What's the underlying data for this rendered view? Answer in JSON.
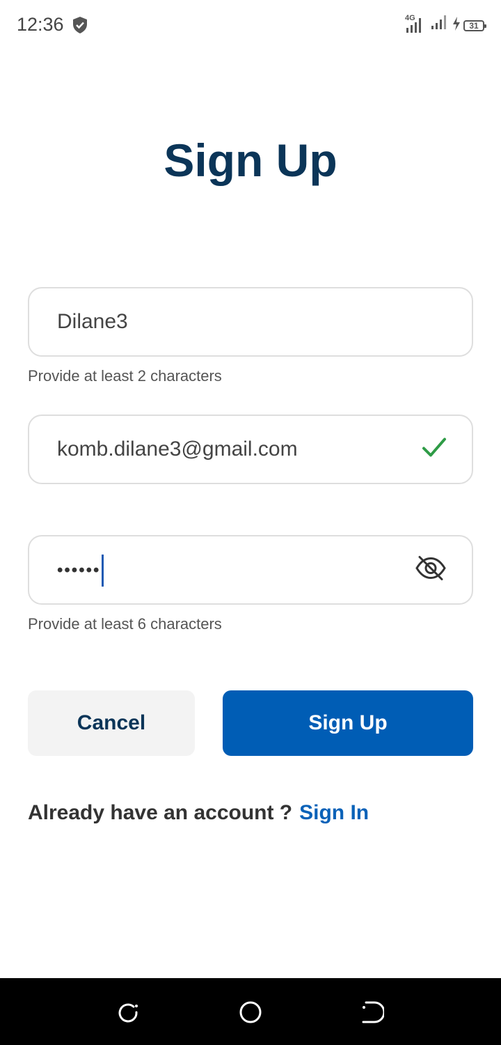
{
  "status_bar": {
    "time": "12:36",
    "network": "4G",
    "battery": "31"
  },
  "title": "Sign Up",
  "form": {
    "username": {
      "value": "Dilane3",
      "hint": "Provide at least 2 characters"
    },
    "email": {
      "value": "komb.dilane3@gmail.com",
      "valid_color": "#2e9b46"
    },
    "password": {
      "masked_value": "••••••",
      "hint": "Provide at least 6 characters"
    }
  },
  "buttons": {
    "cancel": "Cancel",
    "signup": "Sign Up"
  },
  "footer": {
    "prompt": "Already have an account ?",
    "link": "Sign In"
  },
  "colors": {
    "primary": "#005db5",
    "title": "#0b3558",
    "link": "#0a62b8"
  },
  "icons": [
    "shield-icon",
    "signal-icon",
    "charging-icon",
    "battery-icon",
    "check-icon",
    "eye-off-icon",
    "recents-nav-icon",
    "home-nav-icon",
    "back-nav-icon"
  ]
}
